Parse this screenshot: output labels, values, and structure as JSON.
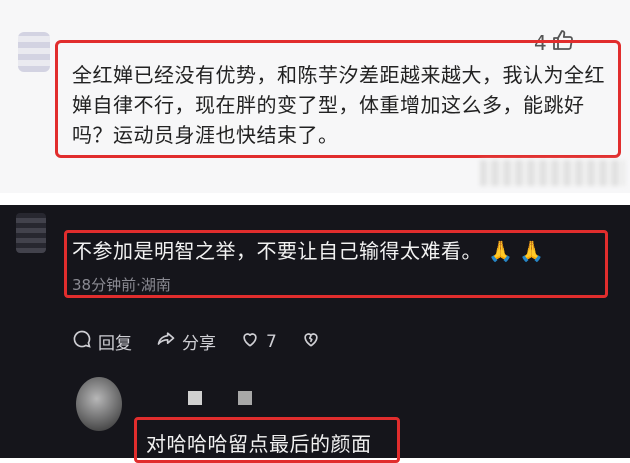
{
  "top_comment": {
    "like_count": "4",
    "text": "全红婵已经没有优势，和陈芋汐差距越来越大，我认为全红婵自律不行，现在胖的变了型，体重增加这么多，能跳好吗？运动员身涯也快结束了。"
  },
  "dark_comment": {
    "text": "不参加是明智之举，不要让自己输得太难看。",
    "emoji": "🙏",
    "meta": "38分钟前·湖南",
    "actions": {
      "reply_label": "回复",
      "share_label": "分享",
      "like_count": "7"
    }
  },
  "reply_comment": {
    "text": "对哈哈哈留点最后的颜面"
  },
  "colors": {
    "highlight_border": "#e12d2d",
    "dark_background": "#15151b",
    "light_background": "#f7f7f8"
  },
  "icons": [
    "thumbs-up-icon",
    "comment-icon",
    "share-icon",
    "heart-icon",
    "dislike-heart-icon",
    "prayer-hands-emoji"
  ]
}
